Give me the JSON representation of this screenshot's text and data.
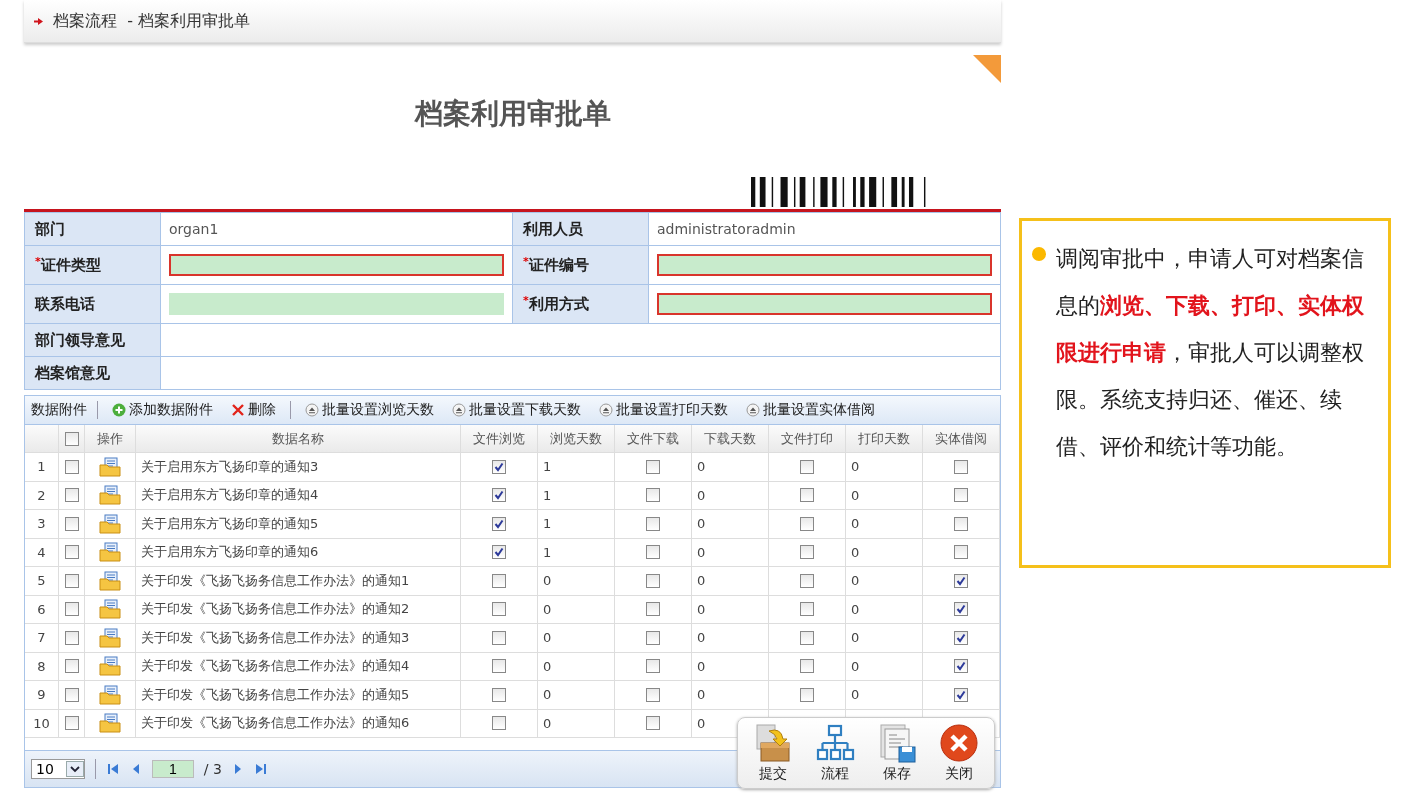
{
  "header": {
    "breadcrumb": "档案流程  - 档案利用审批单"
  },
  "form": {
    "title": "档案利用审批单",
    "rows": [
      {
        "cells": [
          {
            "label": "部门",
            "kind": "text",
            "value": "organ1"
          },
          {
            "label": "利用人员",
            "kind": "text",
            "value": "administratoradmin"
          }
        ]
      },
      {
        "cells": [
          {
            "mark": "*",
            "label": "证件类型",
            "required": true,
            "kind": "input"
          },
          {
            "mark": "*",
            "label": "证件编号",
            "required": true,
            "kind": "input"
          }
        ]
      },
      {
        "cells": [
          {
            "label": "联系电话",
            "required": false,
            "kind": "input"
          },
          {
            "mark": "*",
            "label": "利用方式",
            "required": true,
            "kind": "input"
          }
        ]
      },
      {
        "cells": [
          {
            "label": "部门领导意见",
            "kind": "empty"
          }
        ]
      },
      {
        "cells": [
          {
            "label": "档案馆意见",
            "kind": "empty"
          }
        ]
      }
    ]
  },
  "toolbar": {
    "label": "数据附件",
    "buttons": [
      {
        "kind": "add",
        "label": "添加数据附件"
      },
      {
        "kind": "delete",
        "label": "删除"
      },
      {
        "kind": "batch",
        "label": "批量设置浏览天数"
      },
      {
        "kind": "batch",
        "label": "批量设置下载天数"
      },
      {
        "kind": "batch",
        "label": "批量设置打印天数"
      },
      {
        "kind": "batch",
        "label": "批量设置实体借阅"
      }
    ]
  },
  "table": {
    "select_all": false,
    "op_label": "操作",
    "columns": [
      "数据名称",
      "文件浏览",
      "浏览天数",
      "文件下载",
      "下载天数",
      "文件打印",
      "打印天数",
      "实体借阅"
    ],
    "rows": [
      {
        "num": "1",
        "checked": false,
        "name": "关于启用东方飞扬印章的通知3",
        "browse": true,
        "browse_days": "1",
        "download": false,
        "download_days": "0",
        "print": false,
        "print_days": "0",
        "borrow": false
      },
      {
        "num": "2",
        "checked": false,
        "name": "关于启用东方飞扬印章的通知4",
        "browse": true,
        "browse_days": "1",
        "download": false,
        "download_days": "0",
        "print": false,
        "print_days": "0",
        "borrow": false
      },
      {
        "num": "3",
        "checked": false,
        "name": "关于启用东方飞扬印章的通知5",
        "browse": true,
        "browse_days": "1",
        "download": false,
        "download_days": "0",
        "print": false,
        "print_days": "0",
        "borrow": false
      },
      {
        "num": "4",
        "checked": false,
        "name": "关于启用东方飞扬印章的通知6",
        "browse": true,
        "browse_days": "1",
        "download": false,
        "download_days": "0",
        "print": false,
        "print_days": "0",
        "borrow": false
      },
      {
        "num": "5",
        "checked": false,
        "name": "关于印发《飞扬飞扬务信息工作办法》的通知1",
        "browse": false,
        "browse_days": "0",
        "download": false,
        "download_days": "0",
        "print": false,
        "print_days": "0",
        "borrow": true
      },
      {
        "num": "6",
        "checked": false,
        "name": "关于印发《飞扬飞扬务信息工作办法》的通知2",
        "browse": false,
        "browse_days": "0",
        "download": false,
        "download_days": "0",
        "print": false,
        "print_days": "0",
        "borrow": true
      },
      {
        "num": "7",
        "checked": false,
        "name": "关于印发《飞扬飞扬务信息工作办法》的通知3",
        "browse": false,
        "browse_days": "0",
        "download": false,
        "download_days": "0",
        "print": false,
        "print_days": "0",
        "borrow": true
      },
      {
        "num": "8",
        "checked": false,
        "name": "关于印发《飞扬飞扬务信息工作办法》的通知4",
        "browse": false,
        "browse_days": "0",
        "download": false,
        "download_days": "0",
        "print": false,
        "print_days": "0",
        "borrow": true
      },
      {
        "num": "9",
        "checked": false,
        "name": "关于印发《飞扬飞扬务信息工作办法》的通知5",
        "browse": false,
        "browse_days": "0",
        "download": false,
        "download_days": "0",
        "print": false,
        "print_days": "0",
        "borrow": true
      },
      {
        "num": "10",
        "checked": false,
        "name": "关于印发《飞扬飞扬务信息工作办法》的通知6",
        "browse": false,
        "browse_days": "0",
        "download": false,
        "download_days": "0"
      }
    ]
  },
  "pager": {
    "page_size": "10",
    "page": "1",
    "total": "/ 3"
  },
  "actions": [
    {
      "kind": "submit",
      "label": "提交"
    },
    {
      "kind": "flow",
      "label": "流程"
    },
    {
      "kind": "save",
      "label": "保存"
    },
    {
      "kind": "close",
      "label": "关闭"
    }
  ],
  "note": {
    "text": "调阅审批中，申请人可对档案信息的**浏览、下载、打印、实体权限进行申请**，审批人可以调整权限。系统支持归还、催还、续借、评价和统计等功能。"
  }
}
